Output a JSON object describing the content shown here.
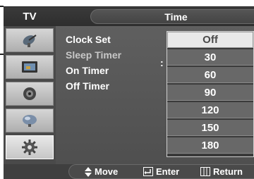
{
  "header": {
    "tv_label": "TV",
    "title": "Time"
  },
  "sidebar": {
    "items": [
      {
        "icon": "satellite-dish-icon"
      },
      {
        "icon": "picture-icon"
      },
      {
        "icon": "sound-icon"
      },
      {
        "icon": "channel-icon"
      },
      {
        "icon": "setup-gear-icon"
      }
    ],
    "active_index": 4
  },
  "menu": {
    "items": [
      {
        "label": "Clock Set"
      },
      {
        "label": "Sleep Timer"
      },
      {
        "label": "On Timer"
      },
      {
        "label": "Off Timer"
      }
    ],
    "separator": ":"
  },
  "dropdown": {
    "options": [
      "Off",
      "30",
      "60",
      "90",
      "120",
      "150",
      "180"
    ],
    "selected": "Off"
  },
  "footer": {
    "move_label": "Move",
    "enter_label": "Enter",
    "return_label": "Return"
  },
  "colors": {
    "background": "#575757",
    "selected_option": "#e9e9e9",
    "option": "#686868"
  }
}
